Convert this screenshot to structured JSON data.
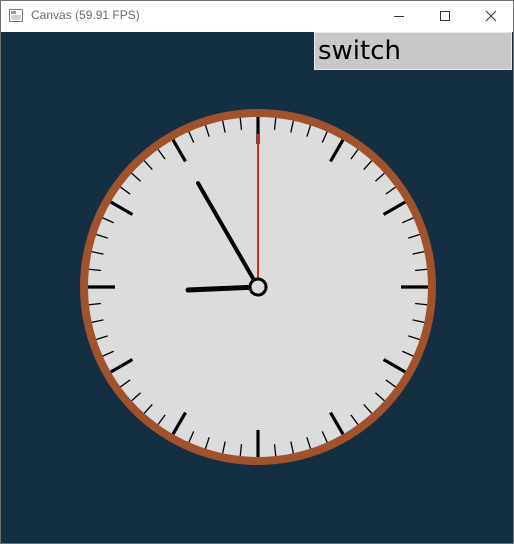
{
  "window": {
    "title": "Canvas (59.91 FPS)"
  },
  "icons": {
    "app": "app-window-icon",
    "minimize": "minimize-icon",
    "maximize": "maximize-icon",
    "close": "close-icon"
  },
  "switch": {
    "label": "switch"
  },
  "clock": {
    "hours": 8,
    "minutes": 55,
    "seconds": 0
  },
  "colors": {
    "canvas_background": "#142e42",
    "clock_face": "#dcdcdc",
    "clock_rim": "#a0522d",
    "hands": "#000000",
    "second_hand": "#cc2a2a",
    "switch_background": "#c8c8c8"
  }
}
